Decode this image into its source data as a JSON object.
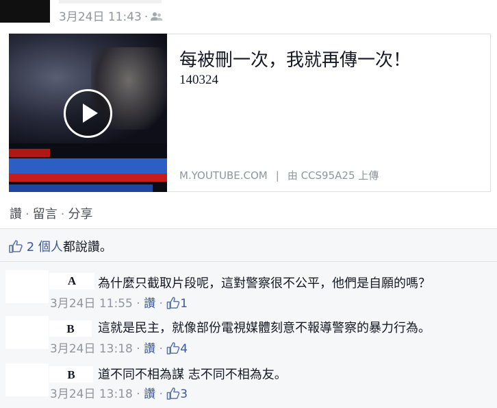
{
  "post": {
    "date": "3月24日 11:43",
    "separator": "·"
  },
  "link_card": {
    "title": "每被刪一次，我就再傳一次！",
    "subtitle": "140324",
    "domain": "M.YOUTUBE.COM",
    "divider": "|",
    "uploader": "由 CCS95A25 上傳"
  },
  "actions": {
    "like": "讚",
    "comment": "留言",
    "share": "分享",
    "separator": "·"
  },
  "likes": {
    "count_text": "2 個人",
    "suffix": "都說讚。"
  },
  "comments": [
    {
      "author_initial": "A",
      "text": "為什麼只截取片段呢，這對警察很不公平，他們是自願的嗎？",
      "time": "3月24日 11:55",
      "like_label": "讚",
      "like_count": "1"
    },
    {
      "author_initial": "B",
      "text": "這就是民主，就像部份電視媒體刻意不報導警察的暴力行為。",
      "time": "3月24日 13:18",
      "like_label": "讚",
      "like_count": "4"
    },
    {
      "author_initial": "B",
      "text": "道不同不相為謀 志不同不相為友。",
      "time": "3月24日 13:18",
      "like_label": "讚",
      "like_count": "3"
    }
  ],
  "colors": {
    "link_blue": "#3b5998",
    "meta_gray": "#90949c",
    "ufi_background": "#f6f7f9"
  },
  "icons": {
    "audience": "people-icon",
    "play": "play-button-icon",
    "like": "thumbs-up-icon"
  }
}
